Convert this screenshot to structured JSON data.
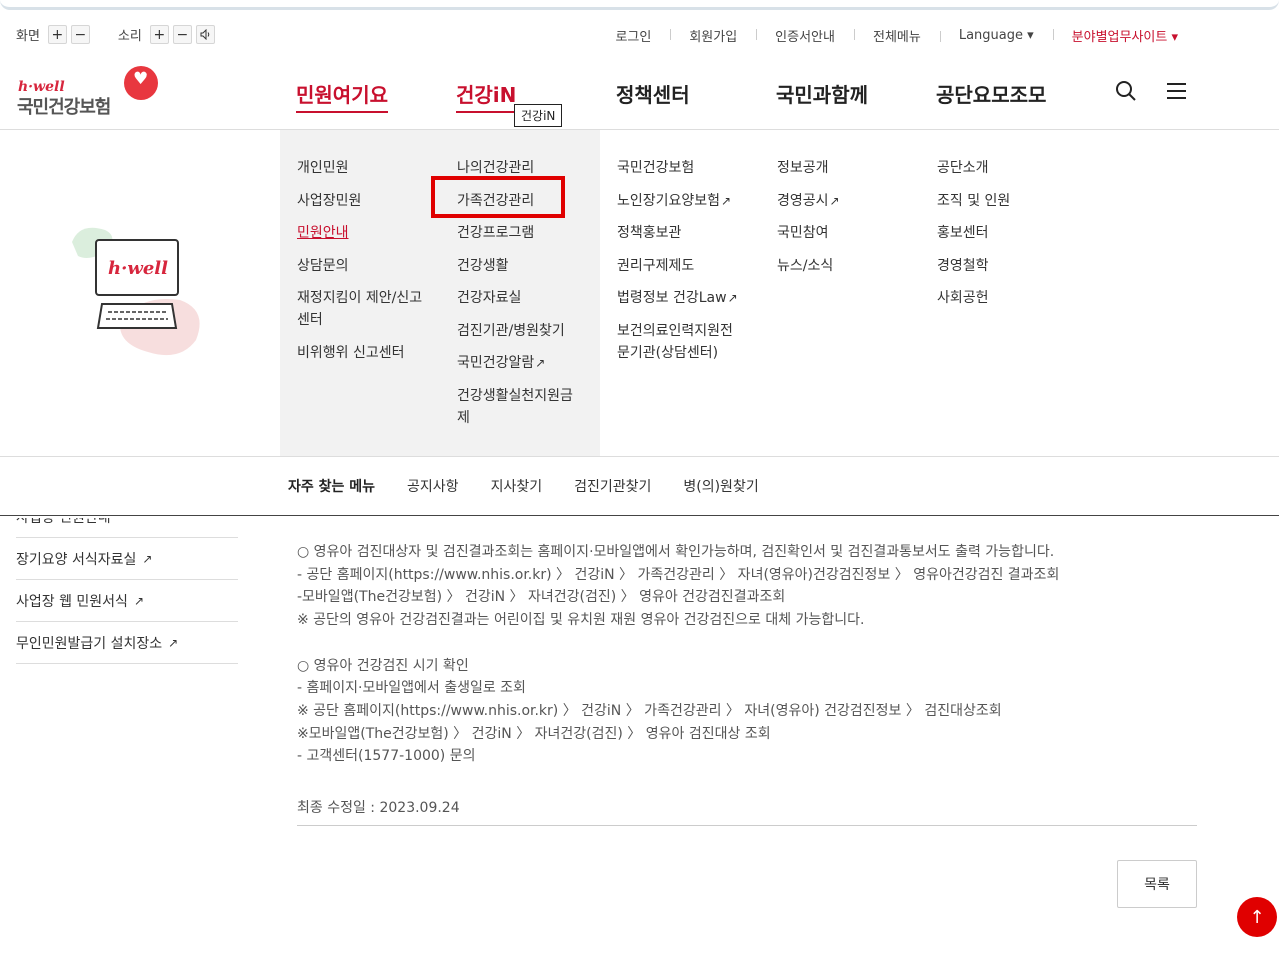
{
  "util": {
    "screen_label": "화면",
    "sound_label": "소리",
    "plus": "+",
    "minus": "−",
    "links": [
      "로그인",
      "회원가입",
      "인증서안내",
      "전체메뉴",
      "Language ▾",
      "분야별업무사이트 ▾"
    ]
  },
  "logo": {
    "hwell": "h·well",
    "name": "국민건강보험"
  },
  "gnb": [
    "민원여기요",
    "건강iN",
    "정책센터",
    "국민과함께",
    "공단요모조모"
  ],
  "tooltip": "건강iN",
  "mega": {
    "col1": [
      "개인민원",
      "사업장민원",
      "민원안내",
      "상담문의",
      "재정지킴이 제안/신고센터",
      "비위행위 신고센터"
    ],
    "col2": [
      "나의건강관리",
      "가족건강관리",
      "건강프로그램",
      "건강생활",
      "건강자료실",
      "검진기관/병원찾기",
      "국민건강알람",
      "건강생활실천지원금제"
    ],
    "col3": [
      "국민건강보험",
      "노인장기요양보험",
      "정책홍보관",
      "권리구제제도",
      "법령정보 건강Law",
      "보건의료인력지원전문기관(상담센터)"
    ],
    "col4": [
      "정보공개",
      "경영공시",
      "국민참여",
      "뉴스/소식"
    ],
    "col5": [
      "공단소개",
      "조직 및 인원",
      "홍보센터",
      "경영철학",
      "사회공헌"
    ],
    "illustration_text": "h·well"
  },
  "quick": [
    "자주 찾는 메뉴",
    "공지사항",
    "지사찾기",
    "검진기관찾기",
    "병(의)원찾기"
  ],
  "side": [
    "사업장 민원안내",
    "장기요양 서식자료실",
    "사업장 웹 민원서식",
    "무인민원발급기 설치장소"
  ],
  "content": [
    "○ 영유아 검진대상자 및 검진결과조회는 홈페이지·모바일앱에서 확인가능하며, 검진확인서 및 검진결과통보서도 출력 가능합니다.",
    " - 공단 홈페이지(https://www.nhis.or.kr) 〉 건강iN 〉 가족건강관리 〉 자녀(영유아)건강검진정보 〉 영유아건강검진 결과조회",
    " -모바일앱(The건강보험) 〉 건강iN 〉 자녀건강(검진) 〉  영유아 건강검진결과조회",
    " ※ 공단의 영유아 건강검진결과는 어린이집 및 유치원 재원 영유아 건강검진으로 대체 가능합니다.",
    "",
    "○ 영유아 건강검진 시기 확인",
    " - 홈페이지·모바일앱에서 출생일로 조회",
    " ※ 공단 홈페이지(https://www.nhis.or.kr) 〉 건강iN 〉 가족건강관리 〉 자녀(영유아) 건강검진정보 〉 검진대상조회",
    " ※모바일앱(The건강보험) 〉 건강iN 〉 자녀건강(검진) 〉 영유아 검진대상 조회",
    " - 고객센터(1577-1000) 문의"
  ],
  "updated": "최종 수정일 : 2023.09.24",
  "list_button": "목록",
  "top_button": "↑",
  "colors": {
    "brand_red": "#c8102e",
    "highlight": "#e00000"
  }
}
